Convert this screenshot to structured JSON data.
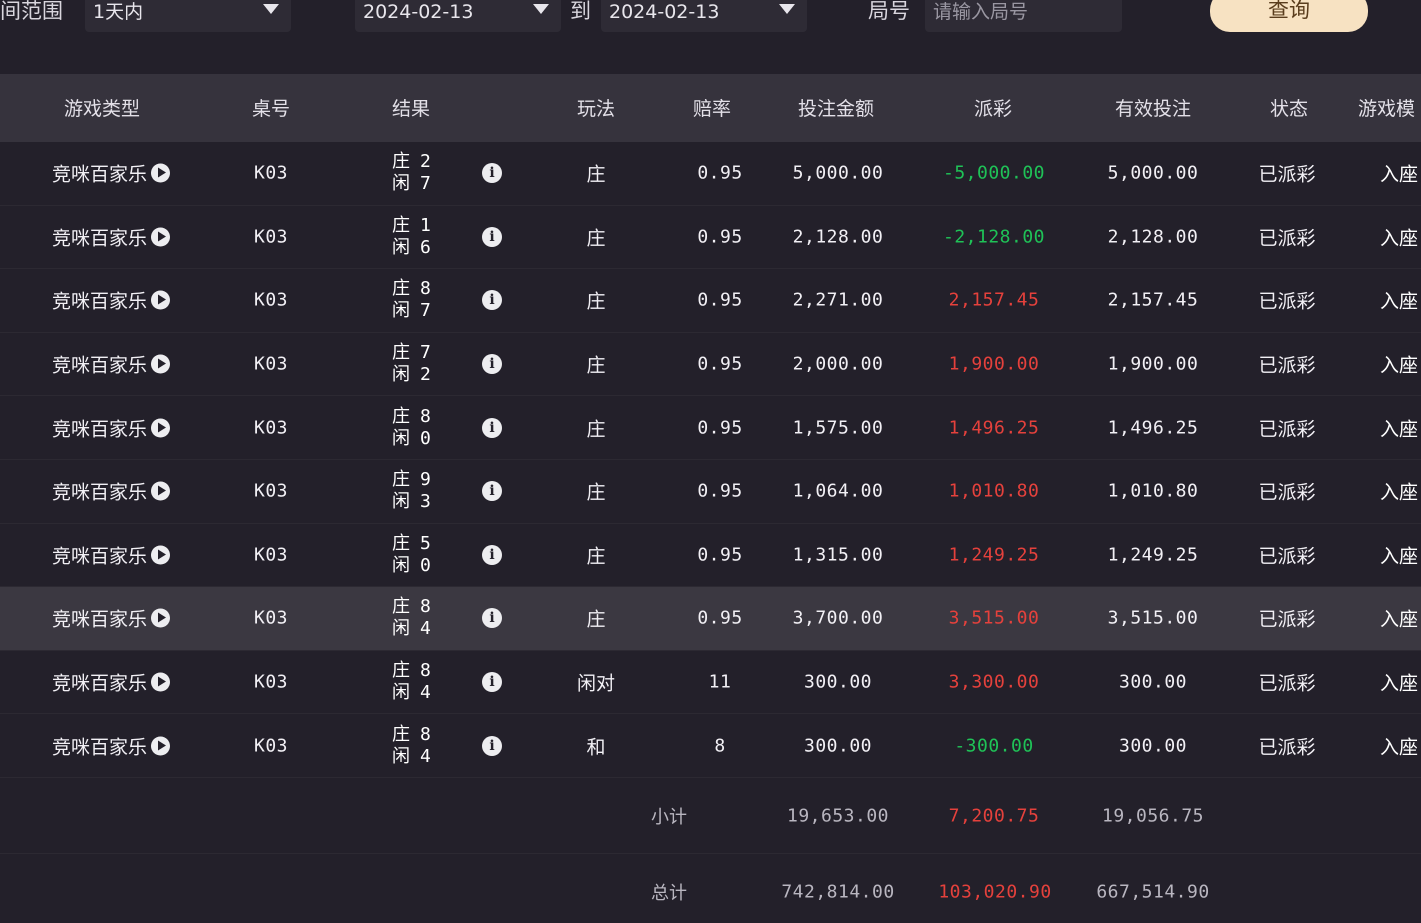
{
  "filters": {
    "time_range_label": "间范围",
    "time_range_value": "1天内",
    "date_from": "2024-02-13",
    "to_label": "到",
    "date_to": "2024-02-13",
    "round_label": "局号",
    "round_placeholder": "请输入局号",
    "query_label": "查询"
  },
  "table": {
    "headers": {
      "game_type": "游戏类型",
      "table_no": "桌号",
      "result": "结果",
      "play": "玩法",
      "odds": "赔率",
      "bet_amount": "投注金额",
      "payout": "派彩",
      "valid_bet": "有效投注",
      "status": "状态",
      "game_mode": "游戏模"
    },
    "rows": [
      {
        "game": "竞咪百家乐",
        "table": "K03",
        "banker_label": "庄",
        "banker": "2",
        "player_label": "闲",
        "player": "7",
        "play": "庄",
        "odds": "0.95",
        "bet": "5,000.00",
        "payout": "-5,000.00",
        "payout_sign": "neg",
        "valid": "5,000.00",
        "status": "已派彩",
        "mode": "入座"
      },
      {
        "game": "竞咪百家乐",
        "table": "K03",
        "banker_label": "庄",
        "banker": "1",
        "player_label": "闲",
        "player": "6",
        "play": "庄",
        "odds": "0.95",
        "bet": "2,128.00",
        "payout": "-2,128.00",
        "payout_sign": "neg",
        "valid": "2,128.00",
        "status": "已派彩",
        "mode": "入座"
      },
      {
        "game": "竞咪百家乐",
        "table": "K03",
        "banker_label": "庄",
        "banker": "8",
        "player_label": "闲",
        "player": "7",
        "play": "庄",
        "odds": "0.95",
        "bet": "2,271.00",
        "payout": "2,157.45",
        "payout_sign": "pos",
        "valid": "2,157.45",
        "status": "已派彩",
        "mode": "入座"
      },
      {
        "game": "竞咪百家乐",
        "table": "K03",
        "banker_label": "庄",
        "banker": "7",
        "player_label": "闲",
        "player": "2",
        "play": "庄",
        "odds": "0.95",
        "bet": "2,000.00",
        "payout": "1,900.00",
        "payout_sign": "pos",
        "valid": "1,900.00",
        "status": "已派彩",
        "mode": "入座"
      },
      {
        "game": "竞咪百家乐",
        "table": "K03",
        "banker_label": "庄",
        "banker": "8",
        "player_label": "闲",
        "player": "0",
        "play": "庄",
        "odds": "0.95",
        "bet": "1,575.00",
        "payout": "1,496.25",
        "payout_sign": "pos",
        "valid": "1,496.25",
        "status": "已派彩",
        "mode": "入座"
      },
      {
        "game": "竞咪百家乐",
        "table": "K03",
        "banker_label": "庄",
        "banker": "9",
        "player_label": "闲",
        "player": "3",
        "play": "庄",
        "odds": "0.95",
        "bet": "1,064.00",
        "payout": "1,010.80",
        "payout_sign": "pos",
        "valid": "1,010.80",
        "status": "已派彩",
        "mode": "入座"
      },
      {
        "game": "竞咪百家乐",
        "table": "K03",
        "banker_label": "庄",
        "banker": "5",
        "player_label": "闲",
        "player": "0",
        "play": "庄",
        "odds": "0.95",
        "bet": "1,315.00",
        "payout": "1,249.25",
        "payout_sign": "pos",
        "valid": "1,249.25",
        "status": "已派彩",
        "mode": "入座"
      },
      {
        "game": "竞咪百家乐",
        "table": "K03",
        "banker_label": "庄",
        "banker": "8",
        "player_label": "闲",
        "player": "4",
        "play": "庄",
        "odds": "0.95",
        "bet": "3,700.00",
        "payout": "3,515.00",
        "payout_sign": "pos",
        "valid": "3,515.00",
        "status": "已派彩",
        "mode": "入座"
      },
      {
        "game": "竞咪百家乐",
        "table": "K03",
        "banker_label": "庄",
        "banker": "8",
        "player_label": "闲",
        "player": "4",
        "play": "闲对",
        "odds": "11",
        "bet": "300.00",
        "payout": "3,300.00",
        "payout_sign": "pos",
        "valid": "300.00",
        "status": "已派彩",
        "mode": "入座"
      },
      {
        "game": "竞咪百家乐",
        "table": "K03",
        "banker_label": "庄",
        "banker": "8",
        "player_label": "闲",
        "player": "4",
        "play": "和",
        "odds": "8",
        "bet": "300.00",
        "payout": "-300.00",
        "payout_sign": "neg",
        "valid": "300.00",
        "status": "已派彩",
        "mode": "入座"
      }
    ],
    "highlighted_row": 7
  },
  "subtotal": {
    "label": "小计",
    "bet": "19,653.00",
    "payout": "7,200.75",
    "valid": "19,056.75"
  },
  "total": {
    "label": "总计",
    "bet": "742,814.00",
    "payout": "103,020.90",
    "valid": "667,514.90"
  },
  "colors": {
    "background": "#23202a",
    "header": "#36333d",
    "loss": "#1fc257",
    "win": "#e5413c",
    "button": "#f7e2c2"
  }
}
